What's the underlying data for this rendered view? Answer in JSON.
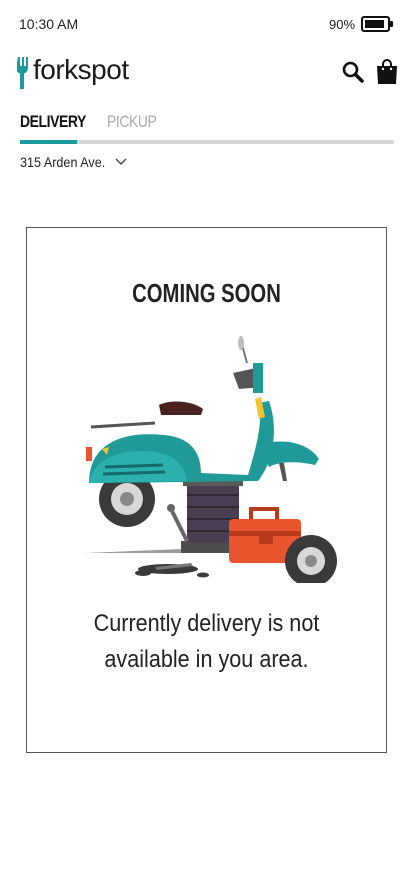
{
  "status_bar": {
    "time": "10:30 AM",
    "battery_percent": "90%",
    "battery_level": 0.9
  },
  "header": {
    "logo_text": "forkspot",
    "brand_color": "#1b9a9c"
  },
  "tabs": [
    {
      "label": "DELIVERY",
      "active": true
    },
    {
      "label": "PICKUP",
      "active": false
    }
  ],
  "address": {
    "value": "315 Arden Ave."
  },
  "card": {
    "title": "COMING SOON",
    "message": "Currently delivery is not available in you area."
  },
  "icons": {
    "logo": "fork-icon",
    "search": "search-icon",
    "bag": "shopping-bag-icon",
    "address_dropdown": "chevron-down-icon"
  }
}
